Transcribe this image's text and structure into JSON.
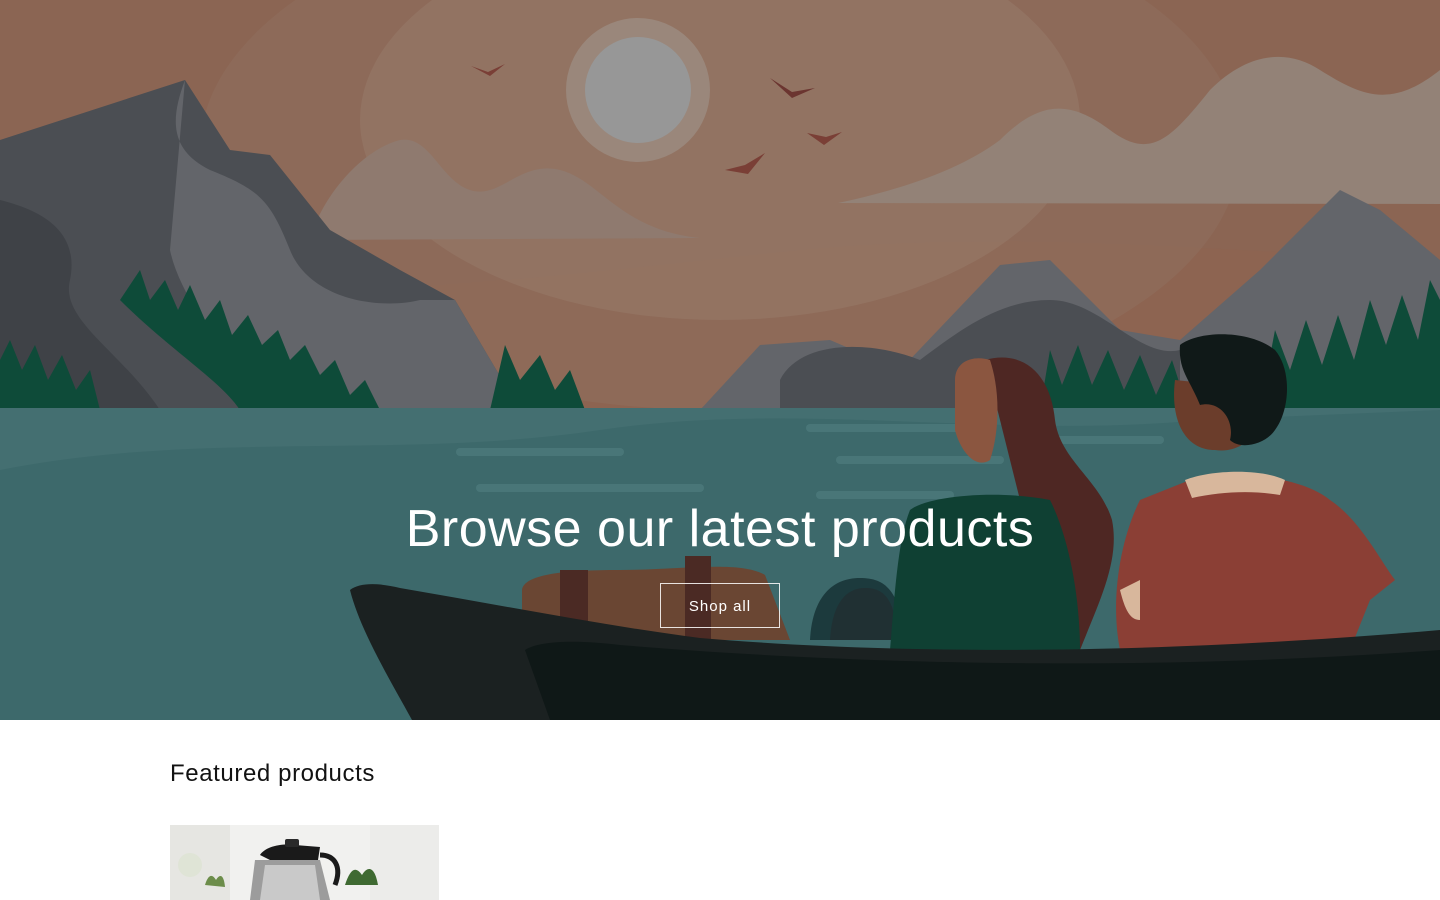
{
  "hero": {
    "title": "Browse our latest products",
    "button_label": "Shop all",
    "colors": {
      "sky": "#8e6654",
      "sun_glow": "#9a8478",
      "sun": "#979797",
      "mountain_dark": "#4b4e53",
      "mountain_light": "#63656a",
      "trees": "#0e4b39",
      "water": "#3d6a6c",
      "boat": "#1b2121"
    }
  },
  "featured": {
    "title": "Featured products",
    "product_image_icon": "kettle-product-image"
  }
}
